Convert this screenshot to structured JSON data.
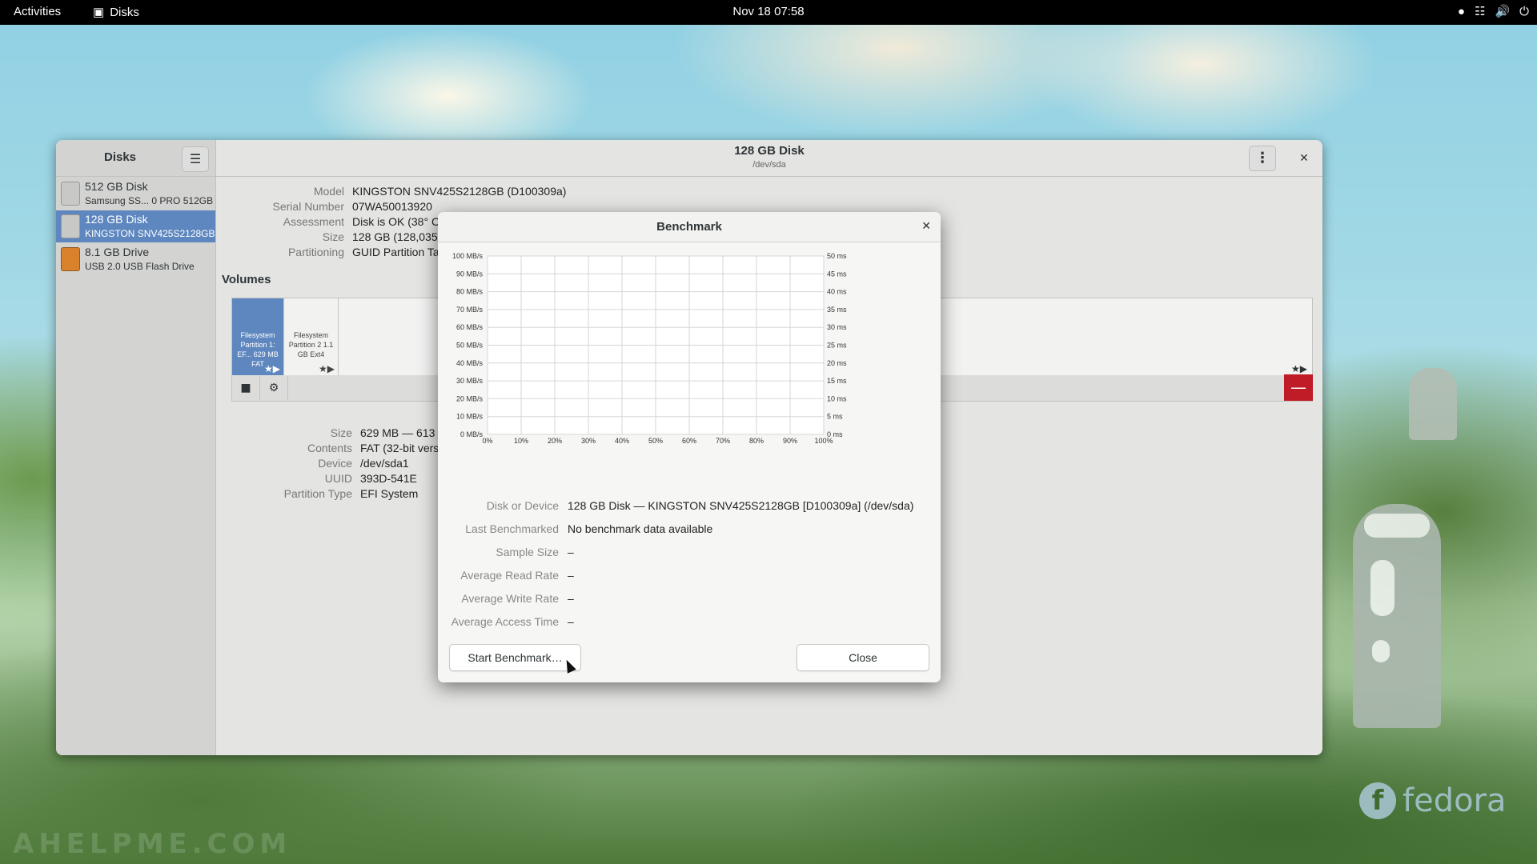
{
  "topbar": {
    "activities": "Activities",
    "app_name": "Disks",
    "clock": "Nov 18  07:58"
  },
  "sidebar": {
    "title": "Disks",
    "drives": [
      {
        "name": "512 GB Disk",
        "model": "Samsung SS...   0 PRO 512GB",
        "color": "#c8c8c6"
      },
      {
        "name": "128 GB Disk",
        "model": "KINGSTON SNV425S2128GB",
        "color": "#c8c8c6"
      },
      {
        "name": "8.1 GB Drive",
        "model": "USB 2.0 USB Flash Drive",
        "color": "#d9822b"
      }
    ]
  },
  "header": {
    "title": "128 GB Disk",
    "subtitle": "/dev/sda"
  },
  "disk_props": [
    {
      "key": "Model",
      "value": "KINGSTON SNV425S2128GB (D100309a)"
    },
    {
      "key": "Serial Number",
      "value": "07WA50013920"
    },
    {
      "key": "Assessment",
      "value": "Disk is OK (38° C / 100° F)"
    },
    {
      "key": "Size",
      "value": "128 GB (128,035,676,160"
    },
    {
      "key": "Partitioning",
      "value": "GUID Partition Table"
    }
  ],
  "volumes": {
    "title": "Volumes",
    "partitions": [
      {
        "label": "Filesystem Partition 1: EF... 629 MB FAT"
      },
      {
        "label": "Filesystem Partition 2 1.1 GB Ext4"
      }
    ],
    "toolbar_stop_icon": "■",
    "toolbar_gear_icon": "⚙",
    "delete_icon": "—"
  },
  "partition_props": [
    {
      "key": "Size",
      "value": "629 MB — 613 MB free"
    },
    {
      "key": "Contents",
      "value": "FAT (32-bit version) — M"
    },
    {
      "key": "Device",
      "value": "/dev/sda1"
    },
    {
      "key": "UUID",
      "value": "393D-541E"
    },
    {
      "key": "Partition Type",
      "value": "EFI System"
    }
  ],
  "benchmark": {
    "title": "Benchmark",
    "fields": [
      {
        "key": "Disk or Device",
        "value": "128 GB Disk — KINGSTON SNV425S2128GB [D100309a] (/dev/sda)"
      },
      {
        "key": "Last Benchmarked",
        "value": "No benchmark data available"
      },
      {
        "key": "Sample Size",
        "value": "–"
      },
      {
        "key": "Average Read Rate",
        "value": "–"
      },
      {
        "key": "Average Write Rate",
        "value": "–"
      },
      {
        "key": "Average Access Time",
        "value": "–"
      }
    ],
    "start_button": "Start Benchmark…",
    "close_button": "Close"
  },
  "chart_data": {
    "type": "line",
    "x_ticks": [
      "0%",
      "10%",
      "20%",
      "30%",
      "40%",
      "50%",
      "60%",
      "70%",
      "80%",
      "90%",
      "100%"
    ],
    "y_left_ticks": [
      "0 MB/s",
      "10 MB/s",
      "20 MB/s",
      "30 MB/s",
      "40 MB/s",
      "50 MB/s",
      "60 MB/s",
      "70 MB/s",
      "80 MB/s",
      "90 MB/s",
      "100 MB/s"
    ],
    "y_right_ticks": [
      "0 ms",
      "5 ms",
      "10 ms",
      "15 ms",
      "20 ms",
      "25 ms",
      "30 ms",
      "35 ms",
      "40 ms",
      "45 ms",
      "50 ms"
    ],
    "ylim_left": [
      0,
      100
    ],
    "ylim_right": [
      0,
      50
    ],
    "xlim": [
      0,
      100
    ],
    "series": [],
    "grid": true
  },
  "branding": {
    "watermark": "AHELPME.COM",
    "fedora": "fedora"
  }
}
